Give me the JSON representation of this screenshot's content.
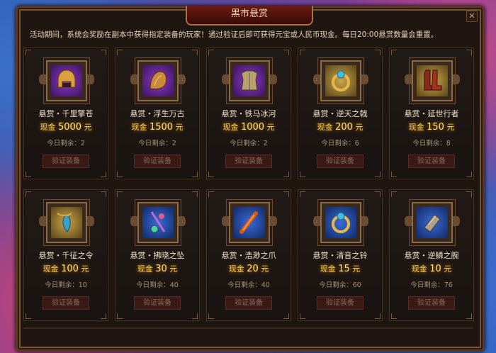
{
  "window": {
    "title": "黑市悬赏",
    "close_glyph": "✕"
  },
  "notice": "活动期间，系统会奖励在副本中获得指定装备的玩家！通过验证后即可获得元宝或人民币现金。每日20:00悬赏数量会重置。",
  "labels": {
    "cash_prefix": "现金",
    "cash_unit": "元",
    "remain_prefix": "今日剩余：",
    "verify_button": "验证装备"
  },
  "bounties": [
    {
      "name": "悬赏・千里擎苍",
      "cash": "5000",
      "remain": "2",
      "icon": "helmet-icon",
      "bg": "purple"
    },
    {
      "name": "悬赏・浮生万古",
      "cash": "1500",
      "remain": "2",
      "icon": "shoulder-icon",
      "bg": "purple"
    },
    {
      "name": "悬赏・铁马冰河",
      "cash": "1000",
      "remain": "2",
      "icon": "armor-icon",
      "bg": "purple"
    },
    {
      "name": "悬赏・逆天之戟",
      "cash": "200",
      "remain": "6",
      "icon": "ring-icon",
      "bg": "gold"
    },
    {
      "name": "悬赏・延世行者",
      "cash": "150",
      "remain": "8",
      "icon": "boots-icon",
      "bg": "gold"
    },
    {
      "name": "悬赏・千征之令",
      "cash": "100",
      "remain": "10",
      "icon": "amulet-icon",
      "bg": "gold"
    },
    {
      "name": "悬赏・拂晓之坠",
      "cash": "30",
      "remain": "40",
      "icon": "pendant-icon",
      "bg": "blue"
    },
    {
      "name": "悬赏・浩渺之爪",
      "cash": "20",
      "remain": "40",
      "icon": "claw-icon",
      "bg": "blue"
    },
    {
      "name": "悬赏・清音之铃",
      "cash": "15",
      "remain": "60",
      "icon": "ring-icon",
      "bg": "blue"
    },
    {
      "name": "悬赏・逆鳞之腕",
      "cash": "10",
      "remain": "76",
      "icon": "bracer-icon",
      "bg": "blue"
    }
  ]
}
